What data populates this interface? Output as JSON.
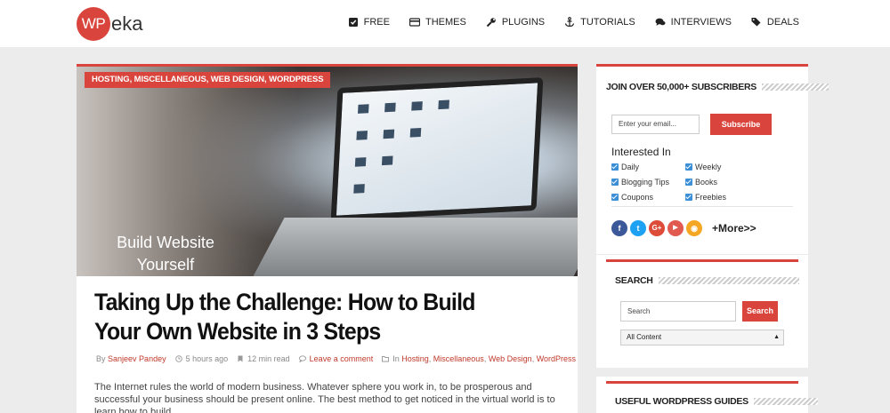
{
  "brand": {
    "logo_mark": "WP",
    "logo_text": "eka",
    "accent": "#d9453d"
  },
  "nav": [
    {
      "label": "FREE",
      "icon": "check-square-icon"
    },
    {
      "label": "THEMES",
      "icon": "credit-card-icon"
    },
    {
      "label": "PLUGINS",
      "icon": "wrench-icon"
    },
    {
      "label": "TUTORIALS",
      "icon": "anchor-icon"
    },
    {
      "label": "INTERVIEWS",
      "icon": "chat-bubbles-icon"
    },
    {
      "label": "DEALS",
      "icon": "tags-icon"
    }
  ],
  "post": {
    "categories_tag": "HOSTING, MISCELLANEOUS, WEB DESIGN, WORDPRESS",
    "hero_caption": "Build Website Yourself",
    "title": "Taking Up the Challenge: How to Build Your Own Website in 3 Steps",
    "meta": {
      "by": "By",
      "author": "Sanjeev Pandey",
      "time": "5 hours ago",
      "read": "12 min read",
      "comment": "Leave a comment",
      "in": "In",
      "categories": [
        "Hosting",
        "Miscellaneous",
        "Web Design",
        "WordPress"
      ]
    },
    "excerpt": "The Internet rules the world of modern business. Whatever sphere you work in, to be prosperous and successful your business should be present online. The best method to get noticed in the virtual world is to learn how to build"
  },
  "subscribe": {
    "title": "JOIN OVER 50,000+ SUBSCRIBERS",
    "email_placeholder": "Enter your email...",
    "button": "Subscribe",
    "interested": "Interested In",
    "options": [
      "Daily",
      "Weekly",
      "Blogging Tips",
      "Books",
      "Coupons",
      "Freebies"
    ],
    "more": "+More>>",
    "social": [
      {
        "label": "f",
        "color": "#3b5998",
        "icon": "facebook-icon"
      },
      {
        "label": "t",
        "color": "#1da1f2",
        "icon": "twitter-icon"
      },
      {
        "label": "G+",
        "color": "#dd4b39",
        "icon": "google-plus-icon"
      },
      {
        "label": "▶",
        "color": "#e05a4f",
        "icon": "youtube-icon"
      },
      {
        "label": "◉",
        "color": "#f5a623",
        "icon": "rss-icon"
      }
    ]
  },
  "search_widget": {
    "title": "SEARCH",
    "placeholder": "Search",
    "button": "Search",
    "select_value": "All Content"
  },
  "guides_widget": {
    "title": "USEFUL WORDPRESS GUIDES"
  }
}
